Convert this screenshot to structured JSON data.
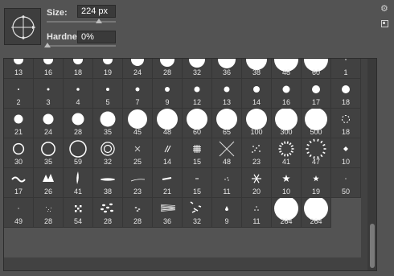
{
  "brush": {
    "size_label": "Size:",
    "size_value": "224 px",
    "size_level": 0.5,
    "hardness_label": "Hardness:",
    "hardness_value": "0%",
    "hardness_level": 0.0
  },
  "presets": [
    {
      "label": "13",
      "shape": "round",
      "d": 12
    },
    {
      "label": "16",
      "shape": "round",
      "d": 12
    },
    {
      "label": "18",
      "shape": "round",
      "d": 12
    },
    {
      "label": "19",
      "shape": "round",
      "d": 12
    },
    {
      "label": "24",
      "shape": "round",
      "d": 16
    },
    {
      "label": "28",
      "shape": "round",
      "d": 18
    },
    {
      "label": "32",
      "shape": "round",
      "d": 20
    },
    {
      "label": "36",
      "shape": "round",
      "d": 22
    },
    {
      "label": "38",
      "shape": "round",
      "d": 26
    },
    {
      "label": "48",
      "shape": "round",
      "d": 30
    },
    {
      "label": "60",
      "shape": "round",
      "d": 30
    },
    {
      "label": "1",
      "shape": "round",
      "d": 1.5
    },
    {
      "label": "2",
      "shape": "round",
      "d": 2
    },
    {
      "label": "3",
      "shape": "round",
      "d": 3
    },
    {
      "label": "4",
      "shape": "round",
      "d": 3.5
    },
    {
      "label": "5",
      "shape": "round",
      "d": 4
    },
    {
      "label": "7",
      "shape": "round",
      "d": 5
    },
    {
      "label": "9",
      "shape": "round",
      "d": 6
    },
    {
      "label": "12",
      "shape": "round",
      "d": 7
    },
    {
      "label": "13",
      "shape": "round",
      "d": 7
    },
    {
      "label": "14",
      "shape": "round",
      "d": 8
    },
    {
      "label": "16",
      "shape": "round",
      "d": 9
    },
    {
      "label": "17",
      "shape": "round",
      "d": 10
    },
    {
      "label": "18",
      "shape": "round",
      "d": 10
    },
    {
      "label": "21",
      "shape": "round",
      "d": 11
    },
    {
      "label": "24",
      "shape": "round",
      "d": 13
    },
    {
      "label": "28",
      "shape": "round",
      "d": 15
    },
    {
      "label": "35",
      "shape": "round",
      "d": 19
    },
    {
      "label": "45",
      "shape": "round",
      "d": 24
    },
    {
      "label": "48",
      "shape": "round",
      "d": 26
    },
    {
      "label": "60",
      "shape": "round",
      "d": 26
    },
    {
      "label": "65",
      "shape": "round",
      "d": 26
    },
    {
      "label": "100",
      "shape": "round",
      "d": 26
    },
    {
      "label": "300",
      "shape": "round",
      "d": 28
    },
    {
      "label": "500",
      "shape": "round",
      "d": 28
    },
    {
      "label": "18",
      "shape": "dashring",
      "d": 9
    },
    {
      "label": "30",
      "shape": "ring",
      "d": 14
    },
    {
      "label": "35",
      "shape": "ring",
      "d": 18
    },
    {
      "label": "59",
      "shape": "ring",
      "d": 22
    },
    {
      "label": "32",
      "shape": "doublering",
      "d": 18
    },
    {
      "label": "25",
      "shape": "cross",
      "d": 8
    },
    {
      "label": "14",
      "shape": "slash",
      "d": 8
    },
    {
      "label": "15",
      "shape": "hash",
      "d": 10
    },
    {
      "label": "48",
      "shape": "x",
      "d": 20
    },
    {
      "label": "23",
      "shape": "dots",
      "d": 10
    },
    {
      "label": "41",
      "shape": "dotring",
      "d": 16
    },
    {
      "label": "47",
      "shape": "dotring",
      "d": 22
    },
    {
      "label": "10",
      "shape": "diamond",
      "d": 6
    },
    {
      "label": "17",
      "shape": "squiggle",
      "d": 16
    },
    {
      "label": "26",
      "shape": "splat",
      "d": 14
    },
    {
      "label": "41",
      "shape": "stroke",
      "d": 18
    },
    {
      "label": "38",
      "shape": "flat",
      "d": 20
    },
    {
      "label": "23",
      "shape": "thin",
      "d": 18
    },
    {
      "label": "21",
      "shape": "dash",
      "d": 14
    },
    {
      "label": "15",
      "shape": "tick",
      "d": 6
    },
    {
      "label": "11",
      "shape": "scatter",
      "d": 8
    },
    {
      "label": "20",
      "shape": "snowflake",
      "d": 12
    },
    {
      "label": "10",
      "shape": "star",
      "d": 10
    },
    {
      "label": "19",
      "shape": "star",
      "d": 8
    },
    {
      "label": "50",
      "shape": "speck",
      "d": 4
    },
    {
      "label": "49",
      "shape": "speck",
      "d": 3
    },
    {
      "label": "28",
      "shape": "grain",
      "d": 8
    },
    {
      "label": "54",
      "shape": "checker",
      "d": 10
    },
    {
      "label": "28",
      "shape": "leaves",
      "d": 14
    },
    {
      "label": "28",
      "shape": "leafsmall",
      "d": 8
    },
    {
      "label": "36",
      "shape": "grass",
      "d": 24
    },
    {
      "label": "32",
      "shape": "scribble",
      "d": 16
    },
    {
      "label": "9",
      "shape": "drop",
      "d": 8
    },
    {
      "label": "11",
      "shape": "triad",
      "d": 8
    },
    {
      "label": "264",
      "shape": "round",
      "d": 30
    },
    {
      "label": "264",
      "shape": "round",
      "d": 30
    }
  ]
}
